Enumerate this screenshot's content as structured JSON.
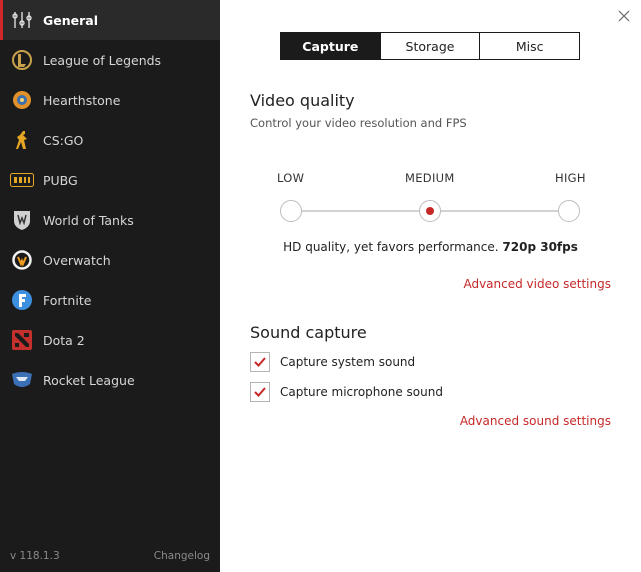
{
  "sidebar": {
    "items": [
      {
        "label": "General",
        "icon": "settings-sliders-icon",
        "active": true
      },
      {
        "label": "League of Legends",
        "icon": "league-of-legends-icon"
      },
      {
        "label": "Hearthstone",
        "icon": "hearthstone-icon"
      },
      {
        "label": "CS:GO",
        "icon": "csgo-icon"
      },
      {
        "label": "PUBG",
        "icon": "pubg-icon"
      },
      {
        "label": "World of Tanks",
        "icon": "world-of-tanks-icon"
      },
      {
        "label": "Overwatch",
        "icon": "overwatch-icon"
      },
      {
        "label": "Fortnite",
        "icon": "fortnite-icon"
      },
      {
        "label": "Dota 2",
        "icon": "dota2-icon"
      },
      {
        "label": "Rocket League",
        "icon": "rocket-league-icon"
      }
    ],
    "version": "v 118.1.3",
    "changelog_label": "Changelog"
  },
  "tabs": [
    {
      "label": "Capture",
      "active": true
    },
    {
      "label": "Storage"
    },
    {
      "label": "Misc"
    }
  ],
  "video": {
    "title": "Video quality",
    "subtitle": "Control your video resolution and FPS",
    "levels": [
      "LOW",
      "MEDIUM",
      "HIGH"
    ],
    "selected": "MEDIUM",
    "description": "HD quality, yet favors performance.",
    "spec": "720p 30fps",
    "advanced_link": "Advanced video settings"
  },
  "sound": {
    "title": "Sound capture",
    "options": [
      {
        "label": "Capture system sound",
        "checked": true
      },
      {
        "label": "Capture microphone sound",
        "checked": true
      }
    ],
    "advanced_link": "Advanced sound settings"
  },
  "colors": {
    "accent": "#c62828",
    "sidebar_bg": "#1b1b1b",
    "active_item_bg": "#2a2a2a"
  }
}
